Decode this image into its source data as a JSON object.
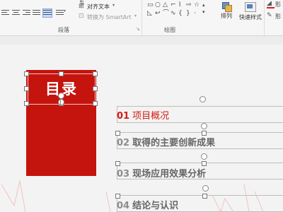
{
  "ribbon": {
    "align_text_label": "对齐文本",
    "smartart_label": "转换为 SmartArt",
    "paragraph_group": "段落",
    "drawing_group": "绘图",
    "arrange_label": "排列",
    "quick_styles_label": "快速样式",
    "shape_fill_label": "形",
    "shape_outline_label": "形"
  },
  "slide": {
    "title": "目录",
    "items": [
      {
        "num": "01",
        "text": "项目概况"
      },
      {
        "num": "02",
        "text": "取得的主要创新成果"
      },
      {
        "num": "03",
        "text": "现场应用效果分析"
      },
      {
        "num": "04",
        "text": "结论与认识"
      }
    ]
  },
  "colors": {
    "accent": "#c4140d"
  }
}
